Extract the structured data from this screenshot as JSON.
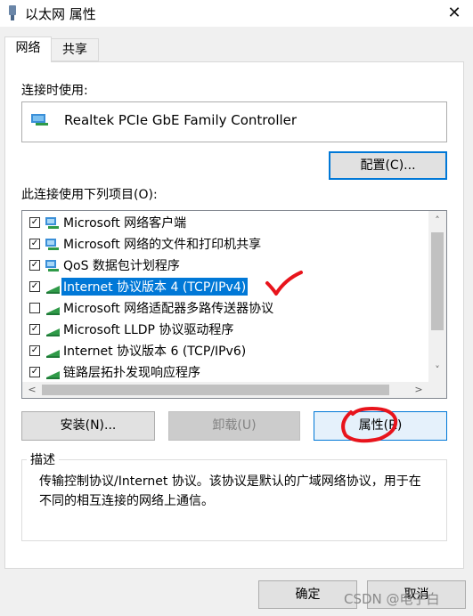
{
  "window": {
    "title": "以太网 属性",
    "close_glyph": "✕"
  },
  "tabs": [
    {
      "label": "网络"
    },
    {
      "label": "共享"
    }
  ],
  "connect_using_label": "连接时使用:",
  "adapter_name": "Realtek PCIe GbE Family Controller",
  "configure_button": "配置(C)...",
  "items_label": "此连接使用下列项目(O):",
  "items": [
    {
      "label": "Microsoft 网络客户端",
      "checked": true,
      "icon": "network-client-icon"
    },
    {
      "label": "Microsoft 网络的文件和打印机共享",
      "checked": true,
      "icon": "file-share-icon"
    },
    {
      "label": "QoS 数据包计划程序",
      "checked": true,
      "icon": "qos-icon"
    },
    {
      "label": "Internet 协议版本 4 (TCP/IPv4)",
      "checked": true,
      "icon": "protocol-icon",
      "selected": true
    },
    {
      "label": "Microsoft 网络适配器多路传送器协议",
      "checked": false,
      "icon": "protocol-icon"
    },
    {
      "label": "Microsoft LLDP 协议驱动程序",
      "checked": true,
      "icon": "protocol-icon"
    },
    {
      "label": "Internet 协议版本 6 (TCP/IPv6)",
      "checked": true,
      "icon": "protocol-icon"
    },
    {
      "label": "链路层拓扑发现响应程序",
      "checked": true,
      "icon": "protocol-icon"
    }
  ],
  "scroll": {
    "up": "˄",
    "down": "˅",
    "left": "<",
    "right": ">"
  },
  "install_button": "安装(N)...",
  "uninstall_button": "卸载(U)",
  "properties_button": "属性(R)",
  "description_title": "描述",
  "description_text": "传输控制协议/Internet 协议。该协议是默认的广域网络协议，用于在不同的相互连接的网络上通信。",
  "ok_button": "确定",
  "cancel_button": "取消",
  "watermark": "CSDN @电子白",
  "colors": {
    "accent": "#0078d7",
    "annotation": "#e8141c"
  }
}
